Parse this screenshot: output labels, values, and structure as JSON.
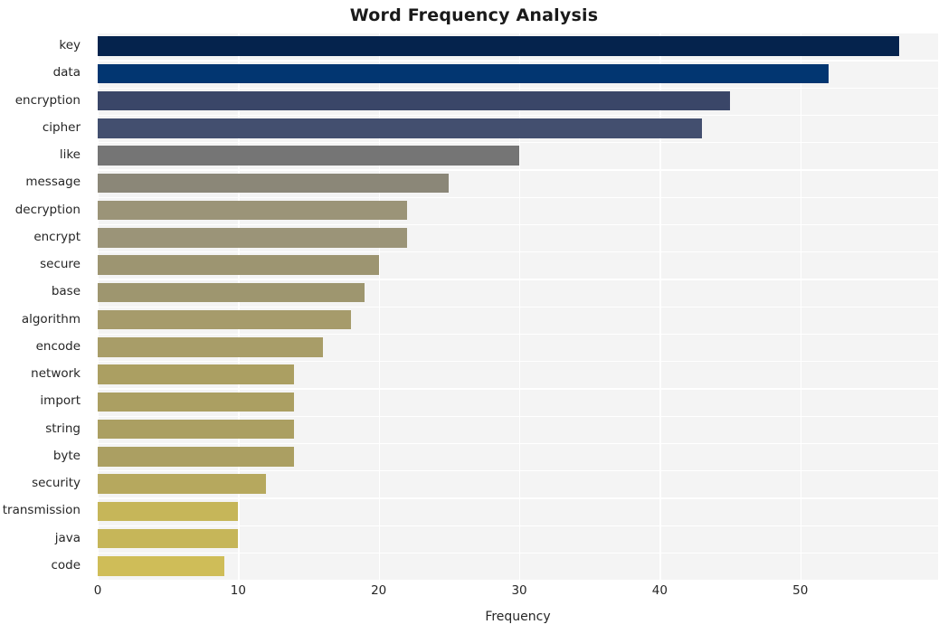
{
  "chart_data": {
    "type": "bar",
    "orientation": "horizontal",
    "title": "Word Frequency Analysis",
    "xlabel": "Frequency",
    "ylabel": "",
    "categories": [
      "key",
      "data",
      "encryption",
      "cipher",
      "like",
      "message",
      "decryption",
      "encrypt",
      "secure",
      "base",
      "algorithm",
      "encode",
      "network",
      "import",
      "string",
      "byte",
      "security",
      "transmission",
      "java",
      "code"
    ],
    "values": [
      57,
      52,
      45,
      43,
      30,
      25,
      22,
      22,
      20,
      19,
      18,
      16,
      14,
      14,
      14,
      14,
      12,
      10,
      10,
      9
    ],
    "bar_colors": [
      "#05234d",
      "#023671",
      "#3a4668",
      "#434f6f",
      "#757575",
      "#8b8778",
      "#9b9478",
      "#9b9478",
      "#9d9571",
      "#9e966f",
      "#a69b6b",
      "#a89d68",
      "#ab9f62",
      "#ab9f62",
      "#ab9f62",
      "#ab9f62",
      "#b6a85e",
      "#c6b659",
      "#c6b659",
      "#cfbd58"
    ],
    "xlim": [
      0,
      59.8
    ],
    "xticks": [
      0,
      10,
      20,
      30,
      40,
      50
    ],
    "xticklabels": [
      "0",
      "10",
      "20",
      "30",
      "40",
      "50"
    ],
    "grid": true,
    "grid_color": "#ffffff",
    "plot_background": "#f4f4f4",
    "figure_background": "#ffffff",
    "legend": null
  },
  "axis": {
    "x_label_text": "Frequency"
  }
}
